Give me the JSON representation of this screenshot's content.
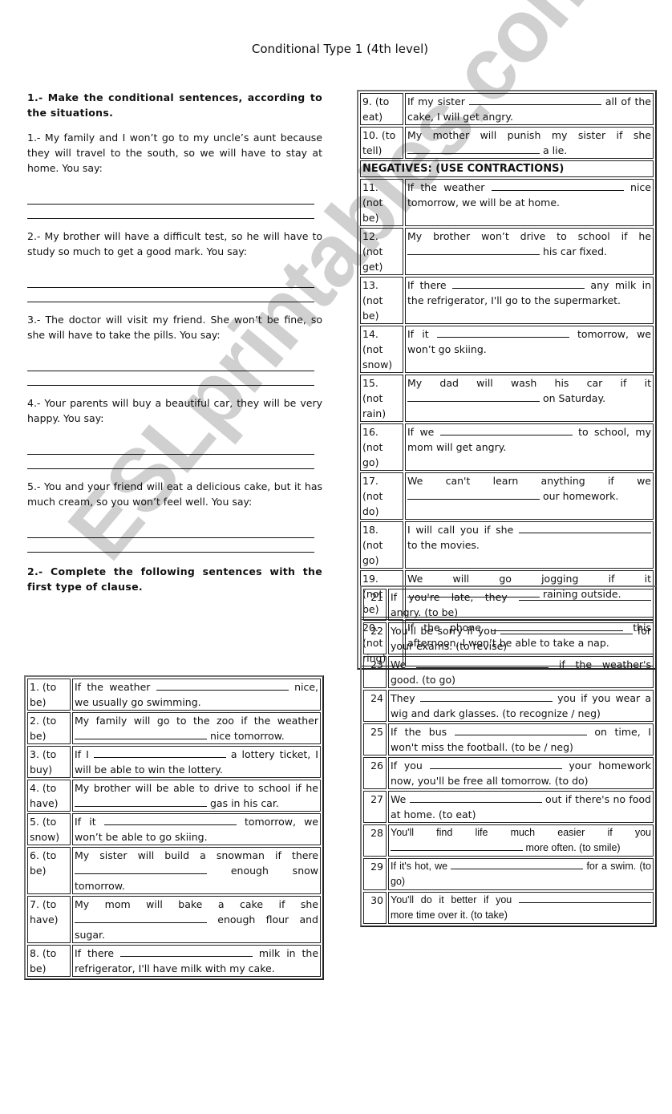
{
  "title": "Conditional Type 1 (4th level)",
  "watermark": "ESLprintables.com",
  "section1": {
    "heading": "1.-  Make the conditional sentences, according to the situations.",
    "situations": [
      "1.-  My family and I won’t go to my uncle’s aunt because they will travel to the south, so we will have to stay at home.  You say:",
      "2.-  My brother will have a difficult test, so he will have to study so much to get a good mark.  You say:",
      "3.-  The doctor will visit my friend. She won’t be fine, so she will have to take the pills.  You say:",
      "4.-  Your parents will buy a beautiful car, they will be very happy.  You say:",
      "5.-  You and your friend will eat a delicious cake, but it has much cream, so you won’t feel well.  You say:"
    ]
  },
  "section2": {
    "heading": "2.-  Complete the following sentences with the first type of clause.",
    "negatives_heading": "NEGATIVES: (USE CONTRACTIONS)",
    "items": [
      {
        "num": "1. (to be)",
        "before": "If the weather",
        "after": "nice, we usually go swimming."
      },
      {
        "num": "2. (to be)",
        "before": "My family will go to the zoo if the weather",
        "after": "nice tomorrow."
      },
      {
        "num": "3. (to buy)",
        "before": "If I",
        "after": "a lottery ticket, I will be able to win the lottery."
      },
      {
        "num": "4. (to have)",
        "before": "My brother will be able to drive to school if he",
        "after": "gas in his car."
      },
      {
        "num": "5. (to snow)",
        "before": "If it",
        "after": "tomorrow, we won’t be able to go skiing."
      },
      {
        "num": "6. (to be)",
        "before": "My sister will build a snowman if there",
        "after": "enough snow tomorrow."
      },
      {
        "num": "7. (to have)",
        "before": "My mom will bake a cake if she",
        "after": "enough flour and sugar."
      },
      {
        "num": "8. (to be)",
        "before": "If there",
        "after": "milk in the refrigerator, I'll have milk with my cake."
      },
      {
        "num": "9. (to eat)",
        "before": "If my sister",
        "after": "all of the cake, I will get angry."
      },
      {
        "num": "10. (to tell)",
        "before": "My mother will punish my sister if she",
        "after": "a lie."
      },
      {
        "num": "11. (not be)",
        "before": "If the weather",
        "after": "nice tomorrow, we will be at home."
      },
      {
        "num": "12. (not get)",
        "before": "My brother won’t drive to school if he",
        "after": "his car fixed."
      },
      {
        "num": "13. (not be)",
        "before": "If there",
        "after": "any milk in the refrigerator, I'll go to the supermarket."
      },
      {
        "num": "14. (not snow)",
        "before": "If it",
        "after": "tomorrow, we won’t go skiing."
      },
      {
        "num": "15. (not rain)",
        "before": "My dad will wash his car if it",
        "after": "on Saturday."
      },
      {
        "num": "16. (not go)",
        "before": "If we",
        "after": "to school, my mom will get angry."
      },
      {
        "num": "17. (not do)",
        "before": "We can't learn anything if we",
        "after": "our homework."
      },
      {
        "num": "18. (not go)",
        "before": "I will call you if she",
        "after": "to the movies."
      },
      {
        "num": "19. (not be)",
        "before": "We will go jogging if it",
        "after": "raining outside."
      },
      {
        "num": "20. (not ring)",
        "before": "If the phone",
        "after": "this afternoon, I won’t be able to take a nap."
      }
    ]
  },
  "section3": {
    "items": [
      {
        "num": "21",
        "before": "If you're late, they",
        "after": "angry. (to be)"
      },
      {
        "num": "22",
        "before": "You'll be sorry if you",
        "after": "for your exams. (to revise)"
      },
      {
        "num": "23",
        "before": "We",
        "after": "if the weather's good. (to go)"
      },
      {
        "num": "24",
        "before": "They",
        "after": "you if you wear a wig and dark glasses. (to recognize / neg)"
      },
      {
        "num": "25",
        "before": "If the bus",
        "after": "on time, I won't miss the football. (to be / neg)"
      },
      {
        "num": "26",
        "before": "If you",
        "after": "your homework now, you'll be free all tomorrow. (to do)"
      },
      {
        "num": "27",
        "before": "We",
        "after": "out if there's no food at home. (to eat)"
      },
      {
        "num": "28",
        "before": "You'll find life much easier if you",
        "after": "more often. (to smile)"
      },
      {
        "num": "29",
        "before": "If it's hot, we",
        "after": "for a swim. (to go)"
      },
      {
        "num": "30",
        "before": "You'll do it better if you",
        "after": "more time over it. (to take)"
      }
    ]
  }
}
